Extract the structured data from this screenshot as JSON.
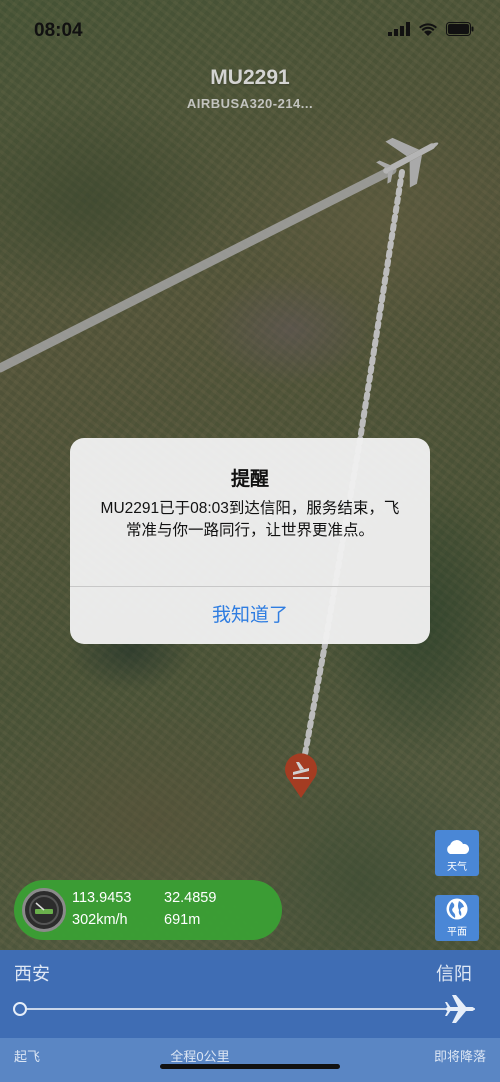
{
  "status_bar": {
    "time": "08:04"
  },
  "flight": {
    "number": "MU2291",
    "aircraft": "AIRBUSA320-214..."
  },
  "alert": {
    "title": "提醒",
    "message": "MU2291已于08:03到达信阳，服务结束，飞常准与你一路同行，让世界更准点。",
    "button_label": "我知道了"
  },
  "side_buttons": {
    "weather_label": "天气",
    "flat_label": "平面"
  },
  "coordinates": {
    "longitude": "113.9453",
    "latitude": "32.4859",
    "speed": "302km/h",
    "altitude": "691m"
  },
  "route": {
    "origin": "西安",
    "destination": "信阳",
    "takeoff_label": "起飞",
    "distance_label": "全程0公里",
    "landing_label": "即将降落"
  },
  "colors": {
    "accent": "#2f7de1",
    "panel": "#3f6db4",
    "coord_pill": "#3aa034",
    "pin": "#c84a2a"
  }
}
